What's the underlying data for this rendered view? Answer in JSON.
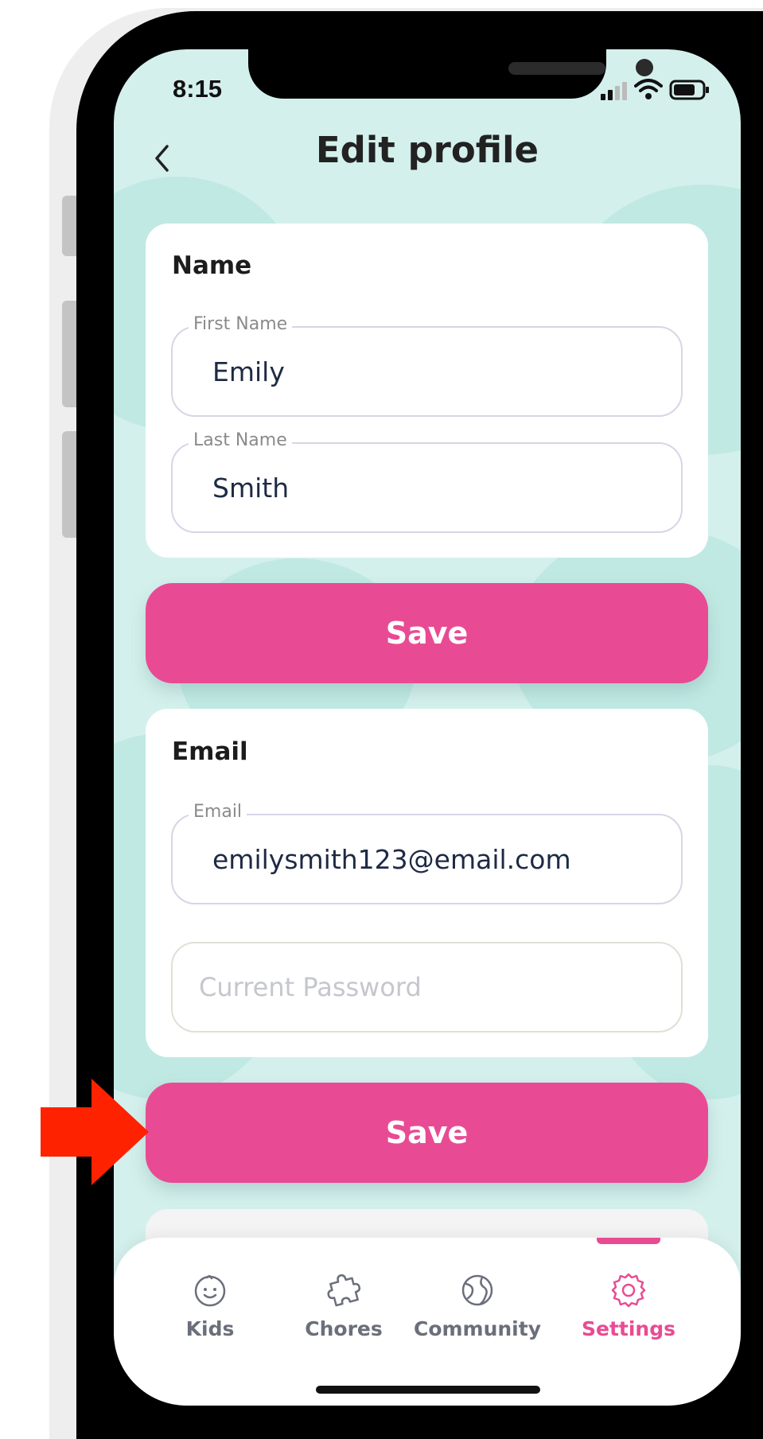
{
  "status_bar": {
    "time": "8:15"
  },
  "header": {
    "title": "Edit profile"
  },
  "name_card": {
    "title": "Name",
    "first_name": {
      "label": "First Name",
      "value": "Emily"
    },
    "last_name": {
      "label": "Last Name",
      "value": "Smith"
    }
  },
  "name_save": {
    "label": "Save"
  },
  "email_card": {
    "title": "Email",
    "email": {
      "label": "Email",
      "value": "emilysmith123@email.com"
    },
    "password": {
      "placeholder": "Current Password"
    }
  },
  "email_save": {
    "label": "Save"
  },
  "tabbar": {
    "items": [
      {
        "label": "Kids",
        "icon": "smile-face-icon",
        "active": false
      },
      {
        "label": "Chores",
        "icon": "puzzle-icon",
        "active": false
      },
      {
        "label": "Community",
        "icon": "globe-icon",
        "active": false
      },
      {
        "label": "Settings",
        "icon": "gear-icon",
        "active": true
      }
    ]
  },
  "colors": {
    "accent": "#e84b94",
    "background": "#d4f0ec",
    "annotation_arrow": "#ff2200"
  }
}
